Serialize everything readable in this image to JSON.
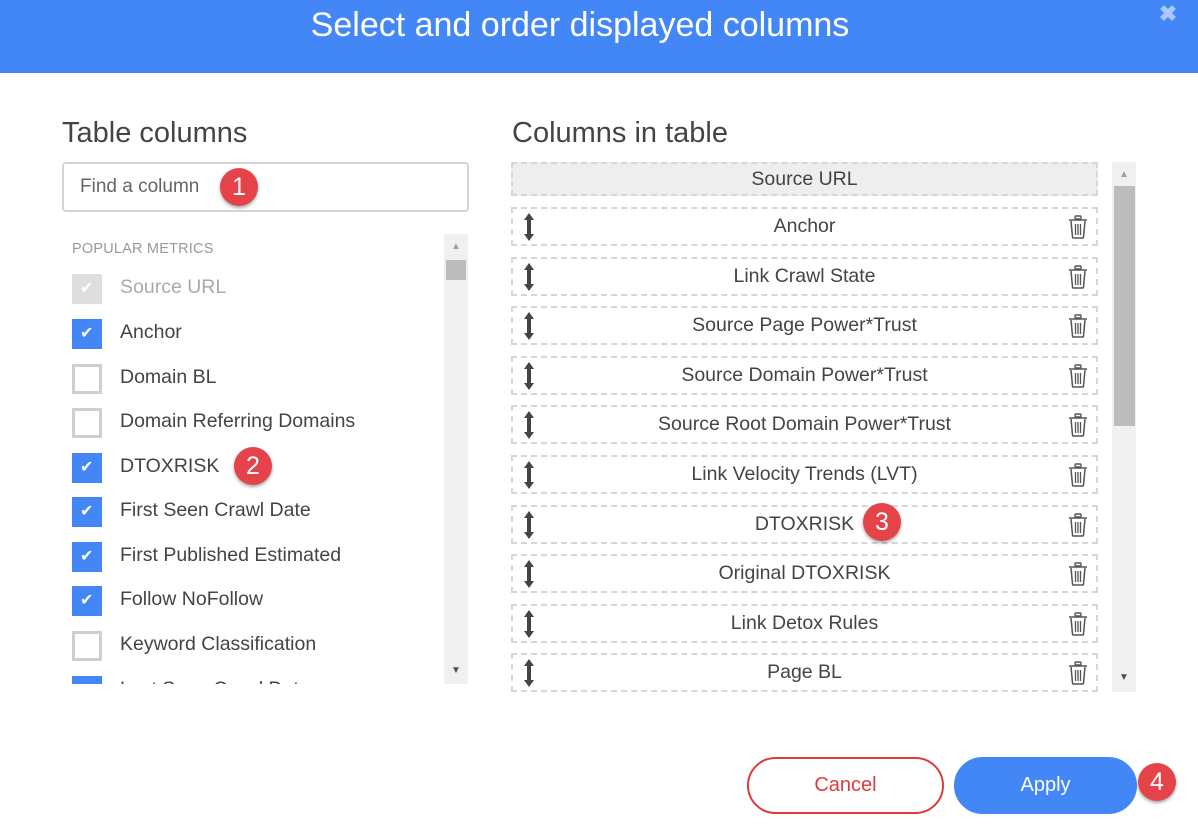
{
  "dialog": {
    "title": "Select and order displayed columns",
    "close_icon": "close-x-icon"
  },
  "left_panel": {
    "title": "Table columns",
    "search": {
      "placeholder": "Find a column",
      "value": ""
    },
    "group_label": "POPULAR METRICS",
    "items": [
      {
        "label": "Source URL",
        "checked": true,
        "disabled": true
      },
      {
        "label": "Anchor",
        "checked": true,
        "disabled": false
      },
      {
        "label": "Domain BL",
        "checked": false,
        "disabled": false
      },
      {
        "label": "Domain Referring Domains",
        "checked": false,
        "disabled": false
      },
      {
        "label": "DTOXRISK",
        "checked": true,
        "disabled": false
      },
      {
        "label": "First Seen Crawl Date",
        "checked": true,
        "disabled": false
      },
      {
        "label": "First Published Estimated",
        "checked": true,
        "disabled": false
      },
      {
        "label": "Follow NoFollow",
        "checked": true,
        "disabled": false
      },
      {
        "label": "Keyword Classification",
        "checked": false,
        "disabled": false
      },
      {
        "label": "Last Seen Crawl Date",
        "checked": true,
        "disabled": false
      }
    ]
  },
  "right_panel": {
    "title": "Columns in table",
    "fixed_column": "Source URL",
    "columns": [
      "Anchor",
      "Link Crawl State",
      "Source Page Power*Trust",
      "Source Domain Power*Trust",
      "Source Root Domain Power*Trust",
      "Link Velocity Trends (LVT)",
      "DTOXRISK",
      "Original DTOXRISK",
      "Link Detox Rules",
      "Page BL"
    ]
  },
  "annotations": [
    "1",
    "2",
    "3",
    "4"
  ],
  "footer": {
    "cancel_label": "Cancel",
    "apply_label": "Apply"
  },
  "colors": {
    "header": "#4287f5",
    "checkbox_checked": "#4287f5",
    "cancel": "#dd3b3b",
    "apply": "#4287f5",
    "badge": "#e5434a"
  }
}
